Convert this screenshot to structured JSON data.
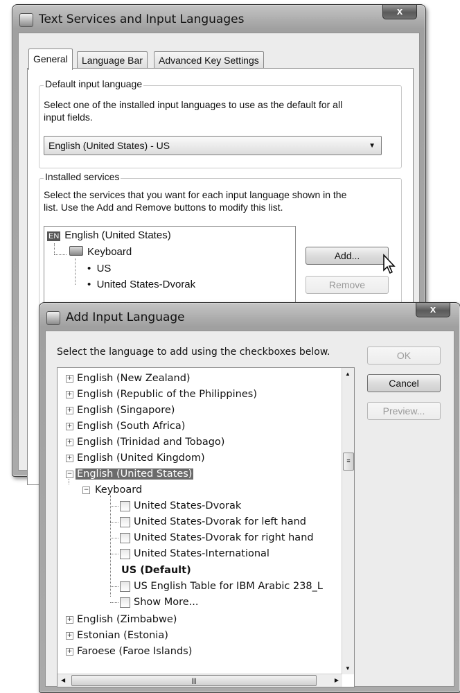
{
  "back_window": {
    "title": "Text Services and Input Languages",
    "close_label": "x",
    "tabs": [
      "General",
      "Language Bar",
      "Advanced Key Settings"
    ],
    "default_group": {
      "label": "Default input language",
      "description_line1": "Select one of the installed input languages to use as the default for all",
      "description_line2": "input fields.",
      "selected": "English (United States) - US"
    },
    "services_group": {
      "label": "Installed services",
      "description_line1": "Select the services that you want for each input language shown in the",
      "description_line2": "list. Use the Add and Remove buttons to modify this list.",
      "language_badge": "EN",
      "language": "English (United States)",
      "category": "Keyboard",
      "layouts": [
        "US",
        "United States-Dvorak"
      ],
      "add_button": "Add...",
      "remove_button": "Remove"
    }
  },
  "front_window": {
    "title": "Add Input Language",
    "close_label": "x",
    "instruction": "Select the language to add using the checkboxes below.",
    "buttons": {
      "ok": "OK",
      "cancel": "Cancel",
      "preview": "Preview..."
    },
    "languages_before": [
      "English (New Zealand)",
      "English (Republic of the Philippines)",
      "English (Singapore)",
      "English (South Africa)",
      "English (Trinidad and Tobago)",
      "English (United Kingdom)"
    ],
    "selected_language": "English (United States)",
    "keyboard_label": "Keyboard",
    "keyboard_options": [
      "United States-Dvorak",
      "United States-Dvorak for left hand",
      "United States-Dvorak for right hand",
      "United States-International"
    ],
    "default_option": "US (Default)",
    "extra_options": [
      "US English Table for IBM Arabic 238_L",
      "Show More..."
    ],
    "languages_after": [
      "English (Zimbabwe)",
      "Estonian (Estonia)",
      "Faroese (Faroe Islands)"
    ]
  }
}
